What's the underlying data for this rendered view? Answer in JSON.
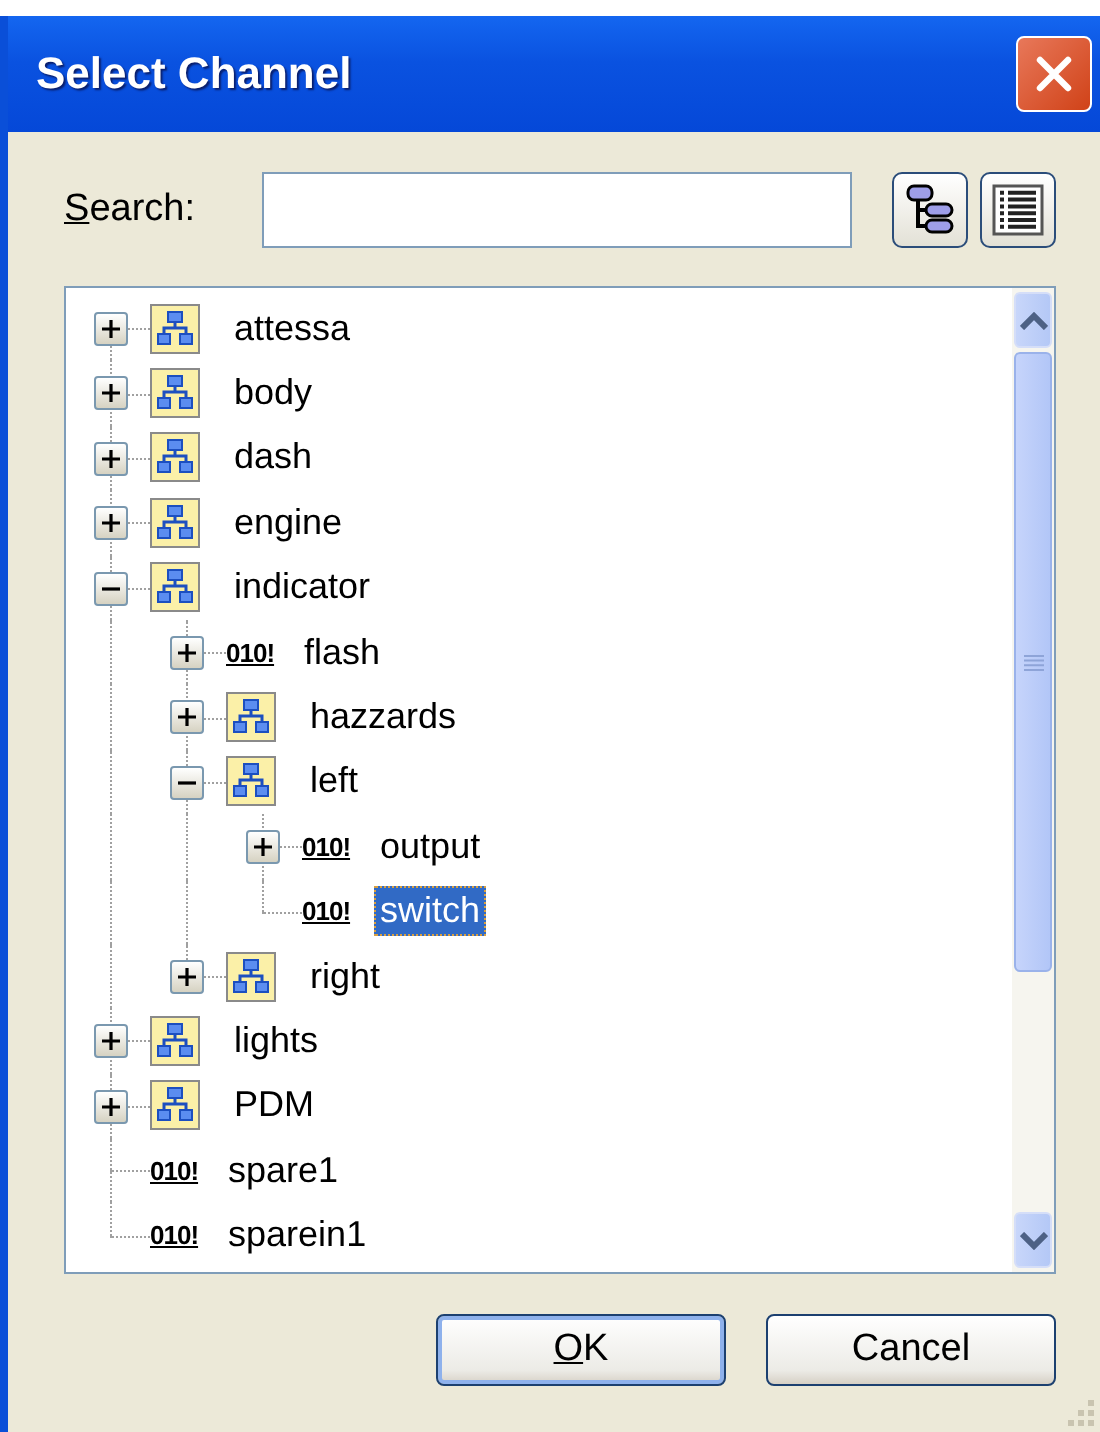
{
  "window": {
    "title": "Select Channel"
  },
  "search": {
    "label": "Search:"
  },
  "view_buttons": [
    {
      "kind": "tree",
      "selected": false
    },
    {
      "kind": "list",
      "selected": false
    }
  ],
  "tree": {
    "items": [
      {
        "kind": "group",
        "label": "attessa",
        "expanded": false,
        "selected": false
      },
      {
        "kind": "group",
        "label": "body",
        "expanded": false,
        "selected": false
      },
      {
        "kind": "group",
        "label": "dash",
        "expanded": false,
        "selected": false
      },
      {
        "kind": "group",
        "label": "engine",
        "expanded": false,
        "selected": false
      },
      {
        "kind": "group",
        "label": "indicator",
        "expanded": true,
        "selected": false,
        "children": [
          {
            "kind": "channel",
            "code": "010!",
            "label": "flash",
            "expanded": false,
            "selected": false
          },
          {
            "kind": "group",
            "label": "hazzards",
            "expanded": false,
            "selected": false
          },
          {
            "kind": "group",
            "label": "left",
            "expanded": true,
            "selected": false,
            "children": [
              {
                "kind": "channel",
                "code": "010!",
                "label": "output",
                "expanded": false,
                "selected": false
              },
              {
                "kind": "channel",
                "code": "010!",
                "label": "switch",
                "selected": true
              }
            ]
          },
          {
            "kind": "group",
            "label": "right",
            "expanded": false,
            "selected": false
          }
        ]
      },
      {
        "kind": "group",
        "label": "lights",
        "expanded": false,
        "selected": false
      },
      {
        "kind": "group",
        "label": "PDM",
        "expanded": false,
        "selected": false
      },
      {
        "kind": "channel",
        "code": "010!",
        "label": "spare1",
        "selected": false
      },
      {
        "kind": "channel",
        "code": "010!",
        "label": "sparein1",
        "selected": false
      }
    ]
  },
  "buttons": [
    {
      "label": "OK",
      "default": true
    },
    {
      "label": "Cancel",
      "default": false
    }
  ]
}
